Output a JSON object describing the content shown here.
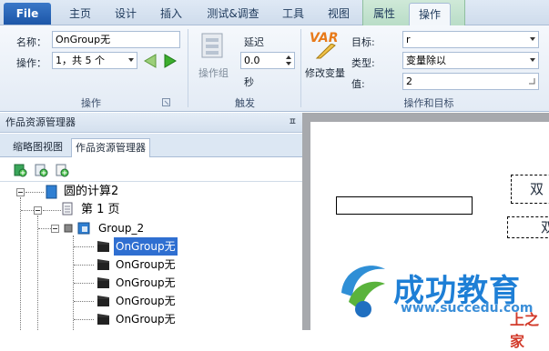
{
  "tabs": {
    "file": "File",
    "items": [
      "主页",
      "设计",
      "插入",
      "测试&调查",
      "工具",
      "视图",
      "属性",
      "操作"
    ],
    "active": "操作"
  },
  "ribbon": {
    "name_label": "名称：",
    "name_value": "OnGroup无",
    "action_label": "操作：",
    "action_value": "1，共 5 个",
    "group1_label": "操作",
    "action_group_label": "操作组",
    "delay_label": "延迟",
    "delay_value": "0.0",
    "seconds_label": "秒",
    "group2_label": "触发",
    "modify_var_label": "修改变量",
    "var_badge": "VAR",
    "target_label": "目标:",
    "target_value": "r",
    "type_label": "类型:",
    "type_value": "变量除以",
    "value_label": "值:",
    "value_value": "2",
    "group3_label": "操作和目标"
  },
  "panel": {
    "title": "作品资源管理器",
    "pin": "ㅍ",
    "tab_thumbnail": "缩略图视图",
    "tab_explorer": "作品资源管理器"
  },
  "tree": {
    "root": "圆的计算2",
    "page": "第 1 页",
    "group": "Group_2",
    "items": [
      "OnGroup无",
      "OnGroup无",
      "OnGroup无",
      "OnGroup无",
      "OnGroup无"
    ]
  },
  "canvas": {
    "text1": "双",
    "text2": "双"
  },
  "watermark": {
    "brand": "成功教育",
    "url": "www.succedu.com",
    "sub": "上之家"
  }
}
